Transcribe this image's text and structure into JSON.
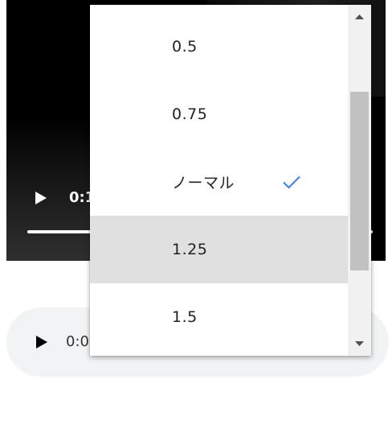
{
  "video_player": {
    "time_display": "0:1",
    "play_icon": "play-icon"
  },
  "audio_player": {
    "time_display": "0:0",
    "play_icon": "play-icon"
  },
  "speed_menu": {
    "selected": "ノーマル",
    "highlighted": "1.25",
    "items": [
      {
        "label": "0.5"
      },
      {
        "label": "0.75"
      },
      {
        "label": "ノーマル",
        "checked": true
      },
      {
        "label": "1.25",
        "hovered": true
      },
      {
        "label": "1.5"
      }
    ],
    "check_icon": "check-icon",
    "check_color": "#4285f4",
    "scroll_up_icon": "arrow-up-icon",
    "scroll_down_icon": "arrow-down-icon"
  },
  "colors": {
    "highlight_row": "#e0e0e0",
    "audio_background": "#f1f3f4",
    "scrollbar_thumb": "#c1c1c1"
  }
}
